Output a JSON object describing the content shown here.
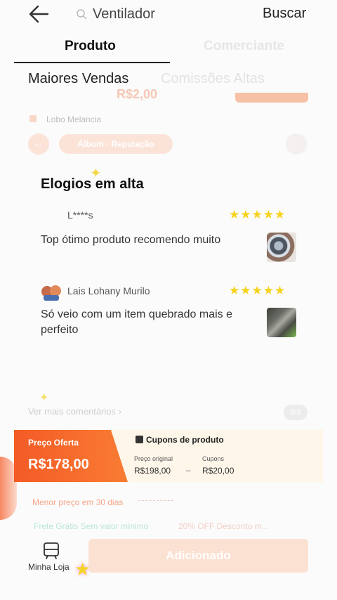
{
  "header": {
    "search_text": "Ventilador",
    "search_button": "Buscar",
    "icons": {
      "back": "arrow-left-icon",
      "search": "search-icon"
    }
  },
  "tabs": [
    {
      "label": "Produto",
      "active": true
    },
    {
      "label": "Comerciante",
      "active": false
    }
  ],
  "subtabs": [
    {
      "label": "Maiores Vendas",
      "active": true
    },
    {
      "label": "Comissões Altas",
      "active": false
    }
  ],
  "ghost": {
    "price": "R$2,00",
    "seller": "Lobo Melancia",
    "pill": "Álbum · Reputação"
  },
  "reviews": {
    "title": "Elogios em alta",
    "items": [
      {
        "user": "L****s",
        "rating": 5,
        "text": "Top ótimo produto recomendo muito"
      },
      {
        "user": "Lais Lohany Murilo",
        "rating": 5,
        "text": "Só veio com um item quebrado mais e perfeito"
      }
    ],
    "more_label": "Ver mais comentários",
    "page_indicator": "8/8"
  },
  "price": {
    "label": "Preço Oferta",
    "value": "R$178,00",
    "coupons_title": "Cupons de produto",
    "original_label": "Preço original",
    "original_value": "R$198,00",
    "dash": "–",
    "coupons_label": "Cupons",
    "coupons_value": "R$20,00"
  },
  "promo": {
    "lowest": "Menor preço em 30 dias",
    "frete": "Frete Grátis Sem valor mínimo",
    "off": "20% OFF Desconto m..."
  },
  "bottom": {
    "store_label": "Minha Loja",
    "add_button": "Adicionado"
  },
  "colors": {
    "accent": "#f45b26",
    "star": "#f6d21b"
  }
}
